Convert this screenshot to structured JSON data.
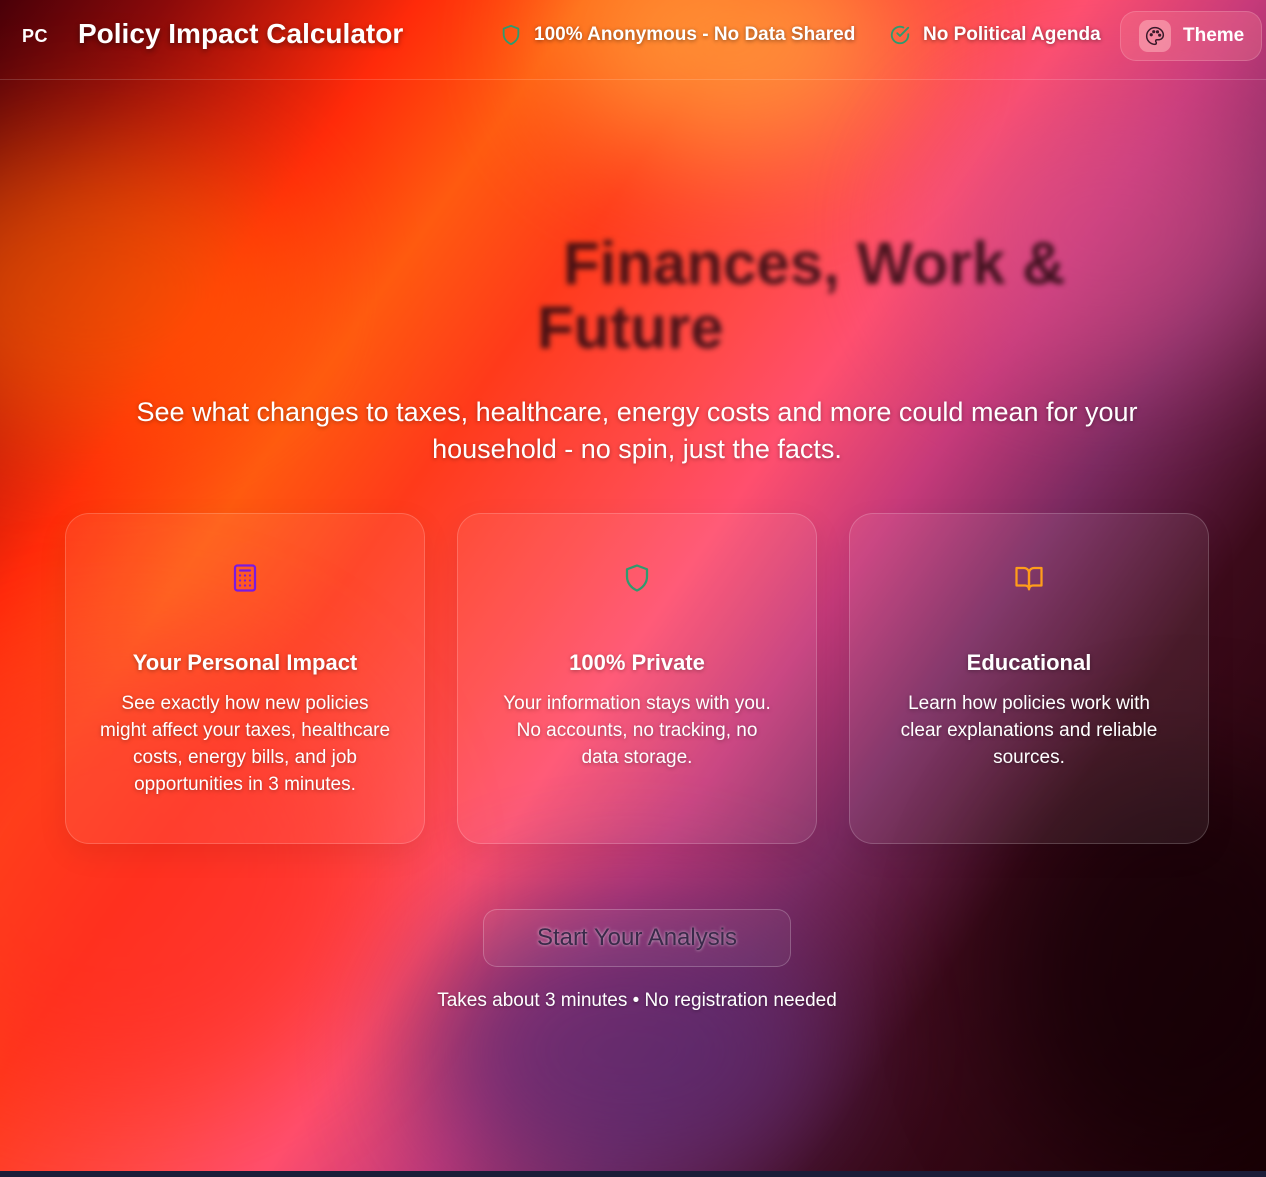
{
  "header": {
    "logo": "PC",
    "title": "Policy Impact Calculator",
    "badges": [
      {
        "label": "100% Anonymous - No Data Shared",
        "icon": "shield-icon"
      },
      {
        "label": "No Political Agenda",
        "icon": "check-circle-icon"
      }
    ],
    "theme_label": "Theme",
    "theme_icon": "palette-icon"
  },
  "hero": {
    "title_line1": "Finances, Work &",
    "title_line2": "Future",
    "subtitle": "See what changes to taxes, healthcare, energy costs and more could mean for your household - no spin, just the facts."
  },
  "features": [
    {
      "title": "Your Personal Impact",
      "text": "See exactly how new policies might affect your taxes, healthcare costs, energy bills, and job opportunities in 3 minutes.",
      "icon": "calculator-icon",
      "icon_color": "#7a1ae0"
    },
    {
      "title": "100% Private",
      "text": "Your information stays with you. No accounts, no tracking, no data storage.",
      "icon": "shield-icon",
      "icon_color": "#2f9a6e"
    },
    {
      "title": "Educational",
      "text": "Learn how policies work with clear explanations and reliable sources.",
      "icon": "book-open-icon",
      "icon_color": "#ff9d1a"
    }
  ],
  "cta": {
    "label": "Start Your Analysis",
    "note": "Takes about 3 minutes • No registration needed"
  },
  "colors": {
    "accent_green": "#2f9a6e",
    "accent_purple": "#7a1ae0",
    "accent_orange": "#ff9d1a"
  }
}
